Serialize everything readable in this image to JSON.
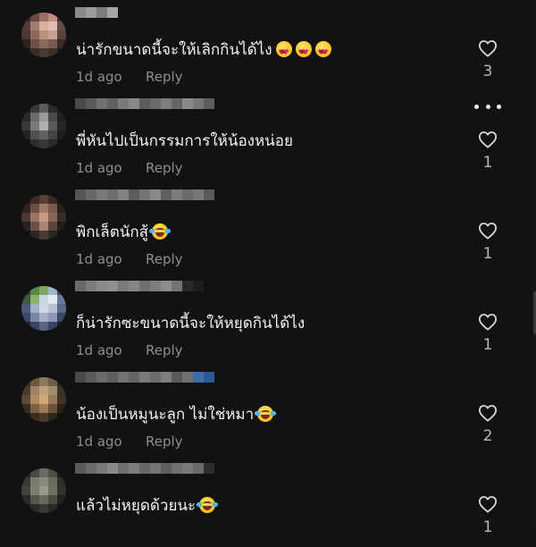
{
  "comments": [
    {
      "text": "น่ารักขนาดนี้จะให้เลิกกินได้ไง",
      "emojis": [
        "smiling-face-with-heart-eyes",
        "smiling-face-with-heart-eyes",
        "smiling-face-with-heart-eyes"
      ],
      "time": "1d ago",
      "reply": "Reply",
      "likes": "3",
      "avatar_colors": [
        "#3a2a26",
        "#6b4a40",
        "#9a6e62",
        "#c08f82",
        "#4a3230",
        "#5a3a34",
        "#a07a6e",
        "#d8b0a0",
        "#e0bcae",
        "#6a4a44",
        "#4c3634",
        "#8c6a5e",
        "#b8907e",
        "#caa08e",
        "#5c423c",
        "#2e2220",
        "#6e5048",
        "#8a6a5c",
        "#7a5a50",
        "#3c2c28",
        "#1e1818",
        "#3a2c28",
        "#4a3a34",
        "#3e302c",
        "#221a18"
      ],
      "username_colors": [
        "#8a8a8a",
        "#9c9c9c",
        "#7c7c7c",
        "#a6a6a6"
      ]
    },
    {
      "text": "พี่หันไปเป็นกรรมการให้น้องหน่อย",
      "emojis": [],
      "time": "1d ago",
      "reply": "Reply",
      "likes": "1",
      "show_more": true,
      "avatar_colors": [
        "#1c1c1c",
        "#3a3a3a",
        "#5a5a5a",
        "#2c2c2c",
        "#181818",
        "#2a2a2a",
        "#6a6a6a",
        "#9a9a9a",
        "#4a4a4a",
        "#202020",
        "#3a3a3a",
        "#7a7a7a",
        "#b0b0b0",
        "#5a5a5a",
        "#262626",
        "#242424",
        "#505050",
        "#606060",
        "#444444",
        "#1e1e1e",
        "#161616",
        "#2e2e2e",
        "#383838",
        "#2a2a2a",
        "#141414"
      ],
      "username_colors": [
        "#4a4a4a",
        "#5a5a5a",
        "#707070",
        "#606060",
        "#7a7a7a",
        "#888888",
        "#5c5c5c",
        "#6a6a6a",
        "#7e7e7e",
        "#666666",
        "#8a8a8a",
        "#767676",
        "#5e5e5e"
      ]
    },
    {
      "text": "พิกเล็ตนักสู้",
      "emojis": [
        "face-with-tears-of-joy"
      ],
      "time": "1d ago",
      "reply": "Reply",
      "likes": "1",
      "avatar_colors": [
        "#1e1a18",
        "#3a2c26",
        "#5a4034",
        "#3a2a24",
        "#1a1616",
        "#2e2420",
        "#6a5044",
        "#a07a66",
        "#7a5a4c",
        "#2a201c",
        "#4a3a32",
        "#9a7462",
        "#c89a82",
        "#8a6656",
        "#3a2c26",
        "#2a2220",
        "#6a5248",
        "#a88672",
        "#5a4438",
        "#221c1a",
        "#161414",
        "#2e2624",
        "#4a3c34",
        "#2e2622",
        "#141212"
      ],
      "username_colors": [
        "#555555",
        "#686868",
        "#7a7a7a",
        "#6e6e6e",
        "#828282",
        "#5c5c5c",
        "#747474",
        "#8a8a8a",
        "#606060",
        "#7c7c7c",
        "#6a6a6a",
        "#787878",
        "#5a5a5a"
      ]
    },
    {
      "text": "ก็น่ารักซะขนาดนี้จะให้หยุดกินได้ไง",
      "emojis": [],
      "time": "1d ago",
      "reply": "Reply",
      "likes": "1",
      "avatar_colors": [
        "#2a3a2a",
        "#5a8a4a",
        "#7aa860",
        "#9ab8c8",
        "#3a4a5a",
        "#3e5a3a",
        "#8ab06a",
        "#c8d8e0",
        "#e0e8f0",
        "#6a7a9a",
        "#4a5a7a",
        "#a0b0c8",
        "#d0d8e8",
        "#b8c0d8",
        "#5a6a8a",
        "#3a4a6a",
        "#7a88a8",
        "#a8b0c8",
        "#8a96b4",
        "#3a4664",
        "#1e2434",
        "#3a4460",
        "#5a6484",
        "#3a4460",
        "#1a1e2c"
      ],
      "username_colors": [
        "#6a6a6a",
        "#7c7c7c",
        "#8a8a8a",
        "#909090",
        "#7a7a7a",
        "#868686",
        "#6e6e6e",
        "#7e7e7e",
        "#8c8c8c",
        "#747474",
        "#2a2a2a",
        "#1e1e1e"
      ]
    },
    {
      "text": "น้องเป็นหมูนะลูก ไม่ใช่หมา",
      "emojis": [
        "face-with-tears-of-joy"
      ],
      "time": "1d ago",
      "reply": "Reply",
      "likes": "2",
      "avatar_colors": [
        "#3a3224",
        "#6a5a3a",
        "#8a7a5a",
        "#6a5e48",
        "#2c2a22",
        "#4a3c2a",
        "#9a8262",
        "#c0a07a",
        "#a08a6a",
        "#3a3428",
        "#5a4a34",
        "#b08a62",
        "#d0a878",
        "#9a7a56",
        "#3e3424",
        "#3a2e22",
        "#7a6044",
        "#a07c56",
        "#6a5238",
        "#2a221a",
        "#1e1a14",
        "#3a2e22",
        "#4a3a2a",
        "#2e261c",
        "#16140e"
      ],
      "username_colors": [
        "#4a4a4a",
        "#5a5a5a",
        "#6a6a6a",
        "#5e5e5e",
        "#727272",
        "#666666",
        "#7a7a7a",
        "#6c6c6c",
        "#7e7e7e",
        "#5a5a5a",
        "#707070",
        "#3c6ea8",
        "#2a5a98"
      ]
    },
    {
      "text": "แล้วไม่หยุดด้วยนะ",
      "emojis": [
        "face-with-tears-of-joy"
      ],
      "time": "",
      "reply": "",
      "likes": "1",
      "avatar_colors": [
        "#262624",
        "#4a4a44",
        "#6a6a60",
        "#4e4e48",
        "#22221e",
        "#3a3a34",
        "#7a7a6e",
        "#8a8a7c",
        "#6a6a5e",
        "#2e2e2a",
        "#44443e",
        "#7e7e70",
        "#9a9a8a",
        "#6e6e62",
        "#32322c",
        "#2a2a26",
        "#56564e",
        "#6a6a5e",
        "#4a4a42",
        "#222220",
        "#181816",
        "#2a2a26",
        "#3a3a34",
        "#2a2a26",
        "#141412"
      ],
      "username_colors": [
        "#5a5a5a",
        "#6a6a6a",
        "#7a7a7a",
        "#8a8a8a",
        "#6e6e6e",
        "#7e7e7e",
        "#666666",
        "#747474",
        "#5e5e5e",
        "#707070",
        "#7a7a7a",
        "#6a6a6a",
        "#2e2e2e"
      ]
    }
  ],
  "colors": {
    "background": "#121212",
    "text": "#f3f3f3",
    "secondary": "#8e8e8e",
    "count": "#b8b8b8"
  }
}
